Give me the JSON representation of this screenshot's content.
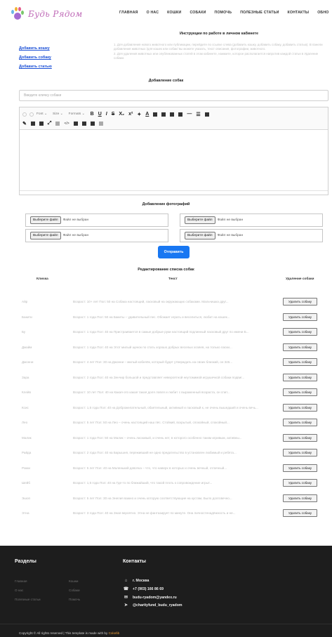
{
  "header": {
    "logo_text": "Будь Рядом",
    "nav": [
      "ГЛАВНАЯ",
      "О НАС",
      "КОШКИ",
      "СОБАКИ",
      "ПОМОЧЬ",
      "ПОЛЕЗНЫЕ СТАТЬИ",
      "КОНТАКТЫ",
      "ОБНО"
    ]
  },
  "sidebar": {
    "items": [
      "Добавить кошку",
      "Добавить собаку",
      "Добавить статью"
    ]
  },
  "instructions": {
    "title": "Инструкции по работе в личном кабинете",
    "p1": "1. Для добавления нового животного или публикации, перейдите по ссылке слева (добавить кошку, добавить собаку, добавить статью). В панели добавления животных /для кошек или собак/ вы можете указать, текст описания, фотографии, животного.",
    "p2": "2. Для удаления животных или опубликованных статей в этом кабинете, нажмите, которое располагается напротив каждой статьи в Удаление собаки."
  },
  "add_dog": {
    "title": "Добавление собак",
    "name_placeholder": "Введите кличку собаки"
  },
  "editor": {
    "font": "Font",
    "size": "Size",
    "formats": "Formats"
  },
  "photos": {
    "title": "Добавление фотографий",
    "button_label": "Выберите файл",
    "no_file": "Файл не выбран"
  },
  "submit_label": "Отправить",
  "table": {
    "title": "Редактирование списка собак",
    "col_name": "Кличка",
    "col_text": "Текст",
    "col_delete": "Удаление собаки",
    "delete_label": "Удалить собаку",
    "rows": [
      {
        "name": "Айр",
        "text": "Возраст: 10+ лет Пол: 50 на Собака настоящий, ласковый на окружающих собаками. Мальчишка друг..."
      },
      {
        "name": "Бакити",
        "text": "Возраст: 1 года Пол: 50 на Бакиты – удивительный пес. Обожает играть и веселиться, любит на кошек..."
      },
      {
        "name": "Бу",
        "text": "Возраст: 1 года Пол: 40 на Пристраивается в самые добрые руки настоящий подлинный ласковый друг по имени Б..."
      },
      {
        "name": "Джайм",
        "text": "Возраст: 1 года Пол: 40 на Этот милый щенок по стать хорошо добрых веселых хозяев, на только ласки..."
      },
      {
        "name": "Джонни",
        "text": "Возраст: 4 лет Пол: 30 на Джонни – милый кобелёк, который будет утверждать на своих близкий, он 345..."
      },
      {
        "name": "Зара",
        "text": "Возраст: 2 года Пол: 40 на Зенчир большой и представляет невероятной неутомимой игрушечкой собаки подвиг..."
      },
      {
        "name": "Клейв",
        "text": "Возраст: 10 лет Пол: 40 на Какая-это какая такая доля ловля и любит с выраженный возраста, он спит..."
      },
      {
        "name": "Ксис",
        "text": "Возраст: 1,5 года Пол: 40 на Доброжелательный, обаятельный, активный и ласковый к, не очень вышедший и очень вечь..."
      },
      {
        "name": "Лео",
        "text": "Возраст: 5 лет Пол: 50 на Лео – очень настоящий наш пёс. Стойкий, вскрытый, спокойный, спокойный..."
      },
      {
        "name": "Малик",
        "text": "Возраст: 1 года Пол: 50 на Малик – очень ласкавый, и очень нет, в которого особенно таким игривым, активны..."
      },
      {
        "name": "Райда",
        "text": "Возраст: 2 года Пол: 40 на Барышня, переживший не одно предательство в установлен любимый и ребята..."
      },
      {
        "name": "Рокки",
        "text": "Возраст: 5 лет Пол: 40 на Маленький девочка – что, что наверх в которых и очень вечный, отличный..."
      },
      {
        "name": "Шейб",
        "text": "Возраст: 1,5 года Пол: 40 на Где-то по ближайший, что такой плоть к сопровождение игрыт..."
      },
      {
        "name": "Эшоп",
        "text": "Возраст: 5 лет Пол: 30 на Энелия важно и очень которую соответствующие на кустам, Было долговечно..."
      },
      {
        "name": "Этна",
        "text": "Возраст: 3 года Пол: 40 на Зная вероятно. Этна не фантазирует по минуте. Она личностенадёжность и не..."
      }
    ]
  },
  "footer": {
    "sections_title": "Разделы",
    "contacts_title": "Контакты",
    "links_col1": [
      "Главная",
      "О нас",
      "Полезные статьи"
    ],
    "links_col2": [
      "Кошки",
      "Собаки",
      "Помочь"
    ],
    "contacts": [
      {
        "icon": "home-icon",
        "text": "г. Москва"
      },
      {
        "icon": "phone-icon",
        "text": "+7 (903) 166 86 69"
      },
      {
        "icon": "mail-icon",
        "text": "budu-ryadom@yandex.ru"
      },
      {
        "icon": "telegram-icon",
        "text": "@charityfund_budu_ryadom"
      }
    ],
    "copyright": "Copyright © All rights reserved | This template is made with by ",
    "colorlib": "Colorlib"
  },
  "colors": {
    "link": "#1a4fd6",
    "submit": "#1877f2",
    "footer_bg": "#1d1d1d",
    "logo": "#c06cb8"
  }
}
